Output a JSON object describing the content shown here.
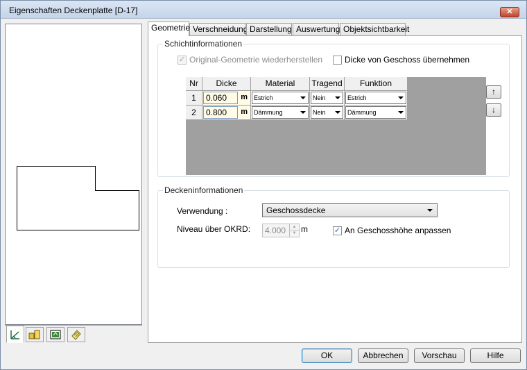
{
  "window": {
    "title": "Eigenschaften Deckenplatte [D-17]",
    "close_label": "✕"
  },
  "tabs": [
    {
      "label": "Geometrie",
      "active": true
    },
    {
      "label": "Verschneidung",
      "active": false
    },
    {
      "label": "Darstellung",
      "active": false
    },
    {
      "label": "Auswertung",
      "active": false
    },
    {
      "label": "Objektsichtbarkeit",
      "active": false
    }
  ],
  "schicht": {
    "legend": "Schichtinformationen",
    "restore_label": "Original-Geometrie wiederherstellen",
    "restore_checked": true,
    "restore_disabled": true,
    "dicke_label": "Dicke von Geschoss übernehmen",
    "dicke_checked": false,
    "columns": [
      "Nr",
      "Dicke",
      "Material",
      "Tragend",
      "Funktion"
    ],
    "rows": [
      {
        "nr": "1",
        "dicke": "0.060",
        "unit": "m",
        "material": "Estrich",
        "tragend": "Nein",
        "funktion": "Estrich"
      },
      {
        "nr": "2",
        "dicke": "0.800",
        "unit": "m",
        "material": "Dämmung",
        "tragend": "Nein",
        "funktion": "Dämmung"
      }
    ],
    "up_label": "↑",
    "down_label": "↓"
  },
  "decken": {
    "legend": "Deckeninformationen",
    "verwendung_label": "Verwendung :",
    "verwendung_value": "Geschossdecke",
    "niveau_label": "Niveau  über OKRD:",
    "niveau_value": "4.000",
    "niveau_unit": "m",
    "anpassen_label": "An Geschosshöhe anpassen",
    "anpassen_checked": true
  },
  "buttons": {
    "ok": "OK",
    "cancel": "Abbrechen",
    "preview": "Vorschau",
    "help": "Hilfe"
  },
  "side_tabs": [
    "geometry-view-icon",
    "objects-3d-icon",
    "layers-icon",
    "notes-icon"
  ]
}
